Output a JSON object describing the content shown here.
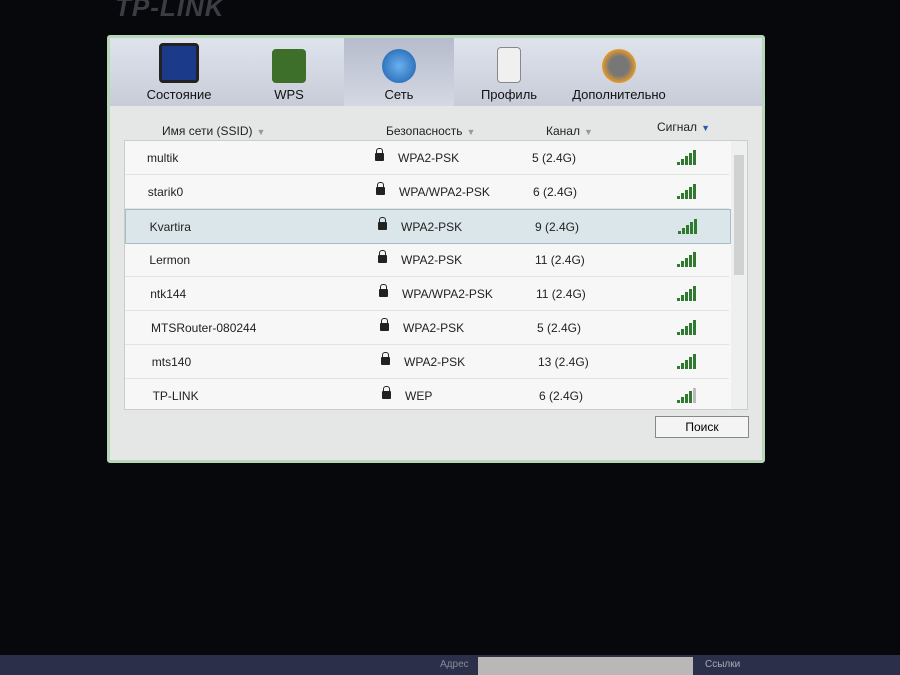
{
  "logo": "TP-LINK",
  "tabs": [
    {
      "label": "Состояние",
      "icon": "monitor-icon"
    },
    {
      "label": "WPS",
      "icon": "wps-lock-icon"
    },
    {
      "label": "Сеть",
      "icon": "globe-icon",
      "active": true
    },
    {
      "label": "Профиль",
      "icon": "profile-icon"
    },
    {
      "label": "Дополнительно",
      "icon": "gears-icon"
    }
  ],
  "columns": {
    "ssid": "Имя сети (SSID)",
    "security": "Безопасность",
    "channel": "Канал",
    "signal": "Сигнал"
  },
  "networks": [
    {
      "ssid": "multik",
      "security": "WPA2-PSK",
      "channel": "5 (2.4G)",
      "signal": 5
    },
    {
      "ssid": "starik0",
      "security": "WPA/WPA2-PSK",
      "channel": "6 (2.4G)",
      "signal": 5
    },
    {
      "ssid": "Kvartira",
      "security": "WPA2-PSK",
      "channel": "9 (2.4G)",
      "signal": 5
    },
    {
      "ssid": "Lermon",
      "security": "WPA2-PSK",
      "channel": "11 (2.4G)",
      "signal": 5
    },
    {
      "ssid": "ntk144",
      "security": "WPA/WPA2-PSK",
      "channel": "11 (2.4G)",
      "signal": 5
    },
    {
      "ssid": "MTSRouter-080244",
      "security": "WPA2-PSK",
      "channel": "5 (2.4G)",
      "signal": 5
    },
    {
      "ssid": "mts140",
      "security": "WPA2-PSK",
      "channel": "13 (2.4G)",
      "signal": 5
    },
    {
      "ssid": "TP-LINK",
      "security": "WEP",
      "channel": "6 (2.4G)",
      "signal": 4
    }
  ],
  "search_button": "Поиск",
  "taskbar": {
    "address_label": "Адрес",
    "links_label": "Ссылки"
  },
  "colors": {
    "signal": "#2f7a2f",
    "selected_row": "#dbe6ea"
  }
}
